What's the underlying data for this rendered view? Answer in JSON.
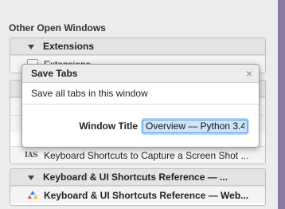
{
  "section": {
    "title": "Other Open Windows"
  },
  "windows": [
    {
      "header": "Extensions",
      "tabs": [
        {
          "title": "Extensions"
        }
      ]
    },
    {
      "header": "",
      "tabs": [
        {
          "title": ""
        },
        {
          "title": ""
        },
        {
          "title": "Keyboard Shortcuts to Capture a Screen Shot ..."
        }
      ]
    },
    {
      "header": "Keyboard & UI Shortcuts Reference — ...",
      "tabs": [
        {
          "title": "Keyboard & UI Shortcuts Reference — Web..."
        }
      ]
    }
  ],
  "favicons": {
    "ias_text": "IAS"
  },
  "dialog": {
    "title": "Save Tabs",
    "close_glyph": "×",
    "message": "Save all tabs in this window",
    "field_label": "Window Title",
    "field_value": "Overview — Python 3.4"
  }
}
